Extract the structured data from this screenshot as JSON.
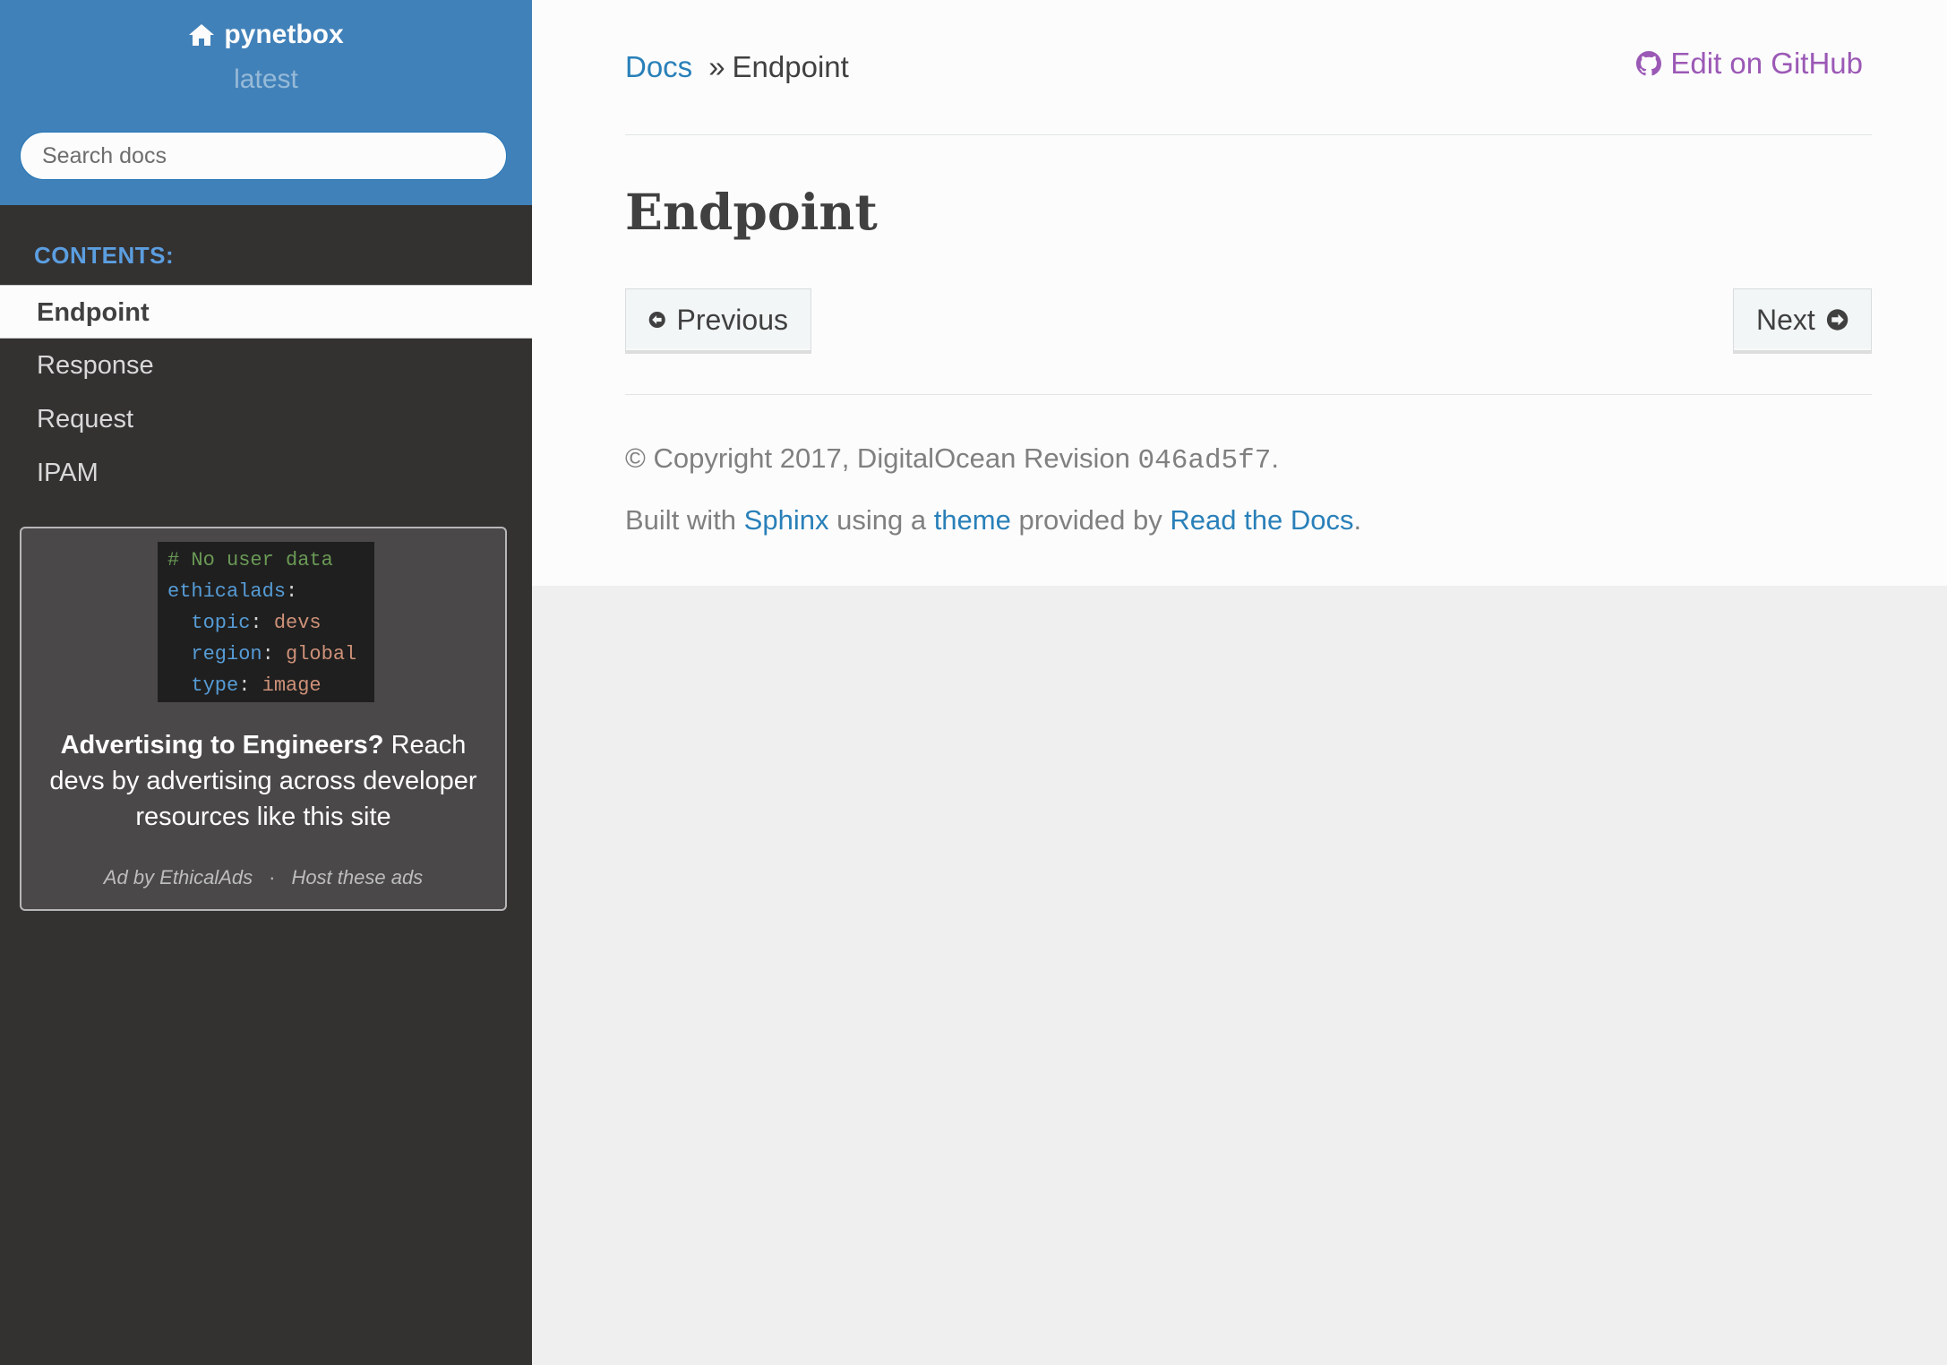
{
  "sidebar": {
    "project_name": "pynetbox",
    "version": "latest",
    "search_placeholder": "Search docs",
    "caption": "CONTENTS:",
    "items": [
      {
        "label": "Endpoint"
      },
      {
        "label": "Response"
      },
      {
        "label": "Request"
      },
      {
        "label": "IPAM"
      }
    ],
    "ad": {
      "code": {
        "comment": "# No user data",
        "root_key": "ethicalads",
        "topic_key": "topic",
        "topic_val": "devs",
        "region_key": "region",
        "region_val": "global",
        "type_key": "type",
        "type_val": "image"
      },
      "headline": "Advertising to Engineers?",
      "body": "Reach devs by advertising across developer resources like this site",
      "by": "Ad by EthicalAds",
      "separator": "·",
      "host": "Host these ads"
    }
  },
  "breadcrumb": {
    "root": "Docs",
    "separator": "»",
    "current": "Endpoint",
    "edit_link": "Edit on GitHub"
  },
  "page": {
    "title": "Endpoint",
    "prev_label": "Previous",
    "next_label": "Next"
  },
  "footer": {
    "copyright": "© Copyright 2017, DigitalOcean Revision",
    "revision": "046ad5f7",
    "copyright_end": ".",
    "built_prefix": "Built with",
    "sphinx": "Sphinx",
    "using": "using a",
    "theme": "theme",
    "provided": "provided by",
    "rtd": "Read the Docs",
    "end": "."
  },
  "colors": {
    "sidebar_top": "#4181b9",
    "sidebar_bg": "#343131",
    "link": "#2980b9",
    "github_link": "#9b59b6"
  }
}
